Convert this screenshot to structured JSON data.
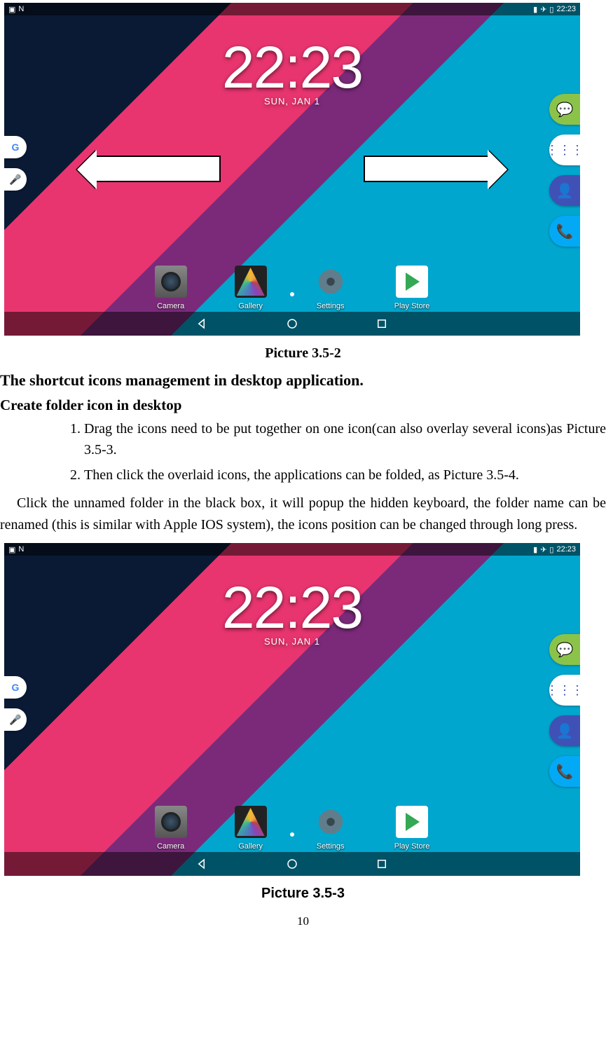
{
  "status": {
    "time": "22:23"
  },
  "clock": {
    "time": "22:23",
    "date": "SUN, JAN 1"
  },
  "apps": {
    "camera": "Camera",
    "gallery": "Gallery",
    "settings": "Settings",
    "playstore": "Play Store"
  },
  "captions": {
    "pic1": "Picture 3.5-2",
    "pic2": "Picture 3.5-3"
  },
  "headings": {
    "h2": "The shortcut icons management in desktop application.",
    "h3": "Create folder icon in desktop"
  },
  "list": {
    "item1": "Drag the icons need to be put together on one icon(can also overlay several icons)as Picture 3.5-3.",
    "item2": "Then click the overlaid icons, the applications can be folded, as Picture 3.5-4."
  },
  "para": "Click the unnamed folder in the black box, it will popup the hidden keyboard, the folder name can be renamed (this is similar with Apple IOS system), the icons position can be changed through long press.",
  "pagenum": "10"
}
